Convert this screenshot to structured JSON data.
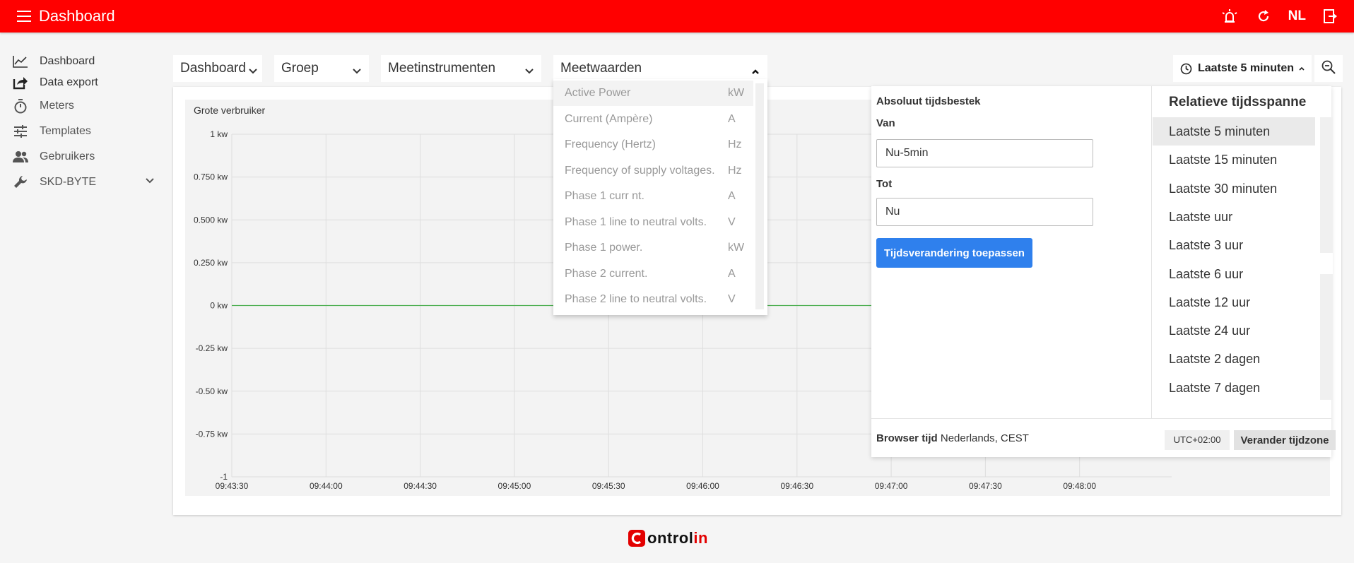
{
  "colors": {
    "brand_red": "#ff0000",
    "accent_blue": "#2f80ed",
    "series_green": "#4caf50"
  },
  "topbar": {
    "title": "Dashboard",
    "language": "NL",
    "icons": [
      "menu-icon",
      "alarm-icon",
      "refresh-icon",
      "logout-icon"
    ]
  },
  "sidebar": {
    "items": [
      {
        "label": "Dashboard",
        "icon": "line-chart-icon"
      },
      {
        "label": "Data export",
        "icon": "export-icon"
      },
      {
        "label": "Meters",
        "icon": "stopwatch-icon"
      },
      {
        "label": "Templates",
        "icon": "sliders-icon"
      },
      {
        "label": "Gebruikers",
        "icon": "users-icon"
      },
      {
        "label": "SKD-BYTE",
        "icon": "wrench-icon"
      }
    ]
  },
  "filters": {
    "dashboard": "Dashboard",
    "groep": "Groep",
    "meetinstrumenten": "Meetinstrumenten",
    "meetwaarden": "Meetwaarden"
  },
  "dropdown": {
    "items": [
      {
        "name": "Active Power",
        "unit": "kW"
      },
      {
        "name": "Current (Ampère)",
        "unit": "A"
      },
      {
        "name": "Frequency (Hertz)",
        "unit": "Hz"
      },
      {
        "name": "Frequency of supply voltages.",
        "unit": "Hz"
      },
      {
        "name": "Phase 1 curr  nt.",
        "unit": "A"
      },
      {
        "name": "Phase 1 line to neutral volts.",
        "unit": "V"
      },
      {
        "name": "Phase 1 power.",
        "unit": "kW"
      },
      {
        "name": "Phase 2 current.",
        "unit": "A"
      },
      {
        "name": "Phase 2 line to neutral volts.",
        "unit": "V"
      }
    ]
  },
  "time_range": {
    "label": "Laatste 5 minuten"
  },
  "time_picker": {
    "absolute_title": "Absoluut tijdsbestek",
    "from_label": "Van",
    "from_value": "Nu-5min",
    "to_label": "Tot",
    "to_value": "Nu",
    "apply_label": "Tijdsverandering toepassen",
    "relative_title": "Relatieve tijdsspanne",
    "relative_options": [
      "Laatste 5 minuten",
      "Laatste 15 minuten",
      "Laatste 30 minuten",
      "Laatste uur",
      "Laatste 3 uur",
      "Laatste 6 uur",
      "Laatste 12 uur",
      "Laatste 24 uur",
      "Laatste 2 dagen",
      "Laatste 7 dagen"
    ],
    "browser_time_label": "Browser tijd",
    "browser_time_value": "Nederlands, CEST",
    "utc_offset": "UTC+02:00",
    "change_tz_label": "Verander tijdzone"
  },
  "chart_data": {
    "type": "line",
    "title": "Grote verbruiker",
    "xlabel": "",
    "ylabel": "",
    "y_ticks": [
      "1 kw",
      "0.750  kw",
      "0.500  kw",
      "0.250  kw",
      "0  kw",
      "-0.25  kw",
      "-0.50  kw",
      "-0.75  kw",
      "-1"
    ],
    "ylim": [
      -1,
      1
    ],
    "x_ticks": [
      "09:43:30",
      "09:44:00",
      "09:44:30",
      "09:45:00",
      "09:45:30",
      "09:46:00",
      "09:46:30",
      "09:47:00",
      "09:47:30",
      "09:48:00"
    ],
    "grid": true,
    "series": [
      {
        "x": [
          "09:43:30",
          "09:48:30"
        ],
        "y": [
          0,
          0
        ]
      }
    ]
  },
  "logo": {
    "text_start": "ontrol",
    "text_end": "in"
  }
}
